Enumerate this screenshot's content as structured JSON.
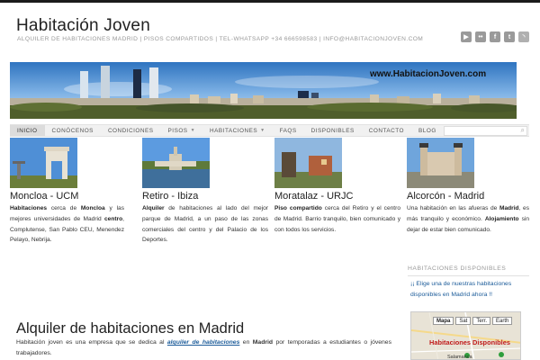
{
  "header": {
    "site_title": "Habitación Joven",
    "tagline": "ALQUILER DE HABITACIONES MADRID | PISOS COMPARTIDOS | TEL-WHATSAPP +34 666598583 | INFO@HABITACIONJOVEN.COM",
    "social_icons": [
      "youtube-icon",
      "flickr-icon",
      "facebook-icon",
      "twitter-icon",
      "rss-icon"
    ]
  },
  "banner": {
    "watermark": "www.HabitacionJoven.com"
  },
  "nav": {
    "items": [
      {
        "label": "INICIO"
      },
      {
        "label": "CONÓCENOS"
      },
      {
        "label": "CONDICIONES"
      },
      {
        "label": "PISOS"
      },
      {
        "label": "HABITACIONES"
      },
      {
        "label": "FAQS"
      },
      {
        "label": "DISPONIBLES"
      },
      {
        "label": "CONTACTO"
      },
      {
        "label": "BLOG"
      }
    ],
    "search_placeholder": ""
  },
  "cards": [
    {
      "title": "Moncloa - UCM",
      "t1": "Habitaciones",
      "t2": " cerca de ",
      "t3": "Moncloa",
      "t4": " y las mejores universidades de Madrid ",
      "t5": "centro",
      "t6": ", Complutense, San Pablo CEU, Menendez Pelayo, Nebrija."
    },
    {
      "title": "Retiro - Ibiza",
      "t1": "Alquiler",
      "t2": " de habitaciones al lado del mejor parque de Madrid, a un paso de las zonas comerciales del centro y del Palacio de los Deportes."
    },
    {
      "title": "Moratalaz - URJC",
      "t1": "Piso compartido",
      "t2": " cerca del Retiro y el centro de Madrid. Barrio tranquilo, bien comunicado y con todos los servicios."
    },
    {
      "title": "Alcorcón - Madrid",
      "t1": "Una habitación en las afueras de ",
      "t2": "Madrid",
      "t3": ", es más tranquilo y económico. ",
      "t4": "Alojamiento",
      "t5": " sin dejar de estar bien comunicado."
    }
  ],
  "sidebar": {
    "title": "HABITACIONES DISPONIBLES",
    "link": "¡¡ Elige una de nuestras habitaciones disponibles en Madrid ahora !!",
    "map": {
      "tabs": [
        "Mapa",
        "Sat",
        "Terr.",
        "Earth"
      ],
      "label": "Habitaciones Disponibles",
      "city": "Salamanca"
    }
  },
  "main": {
    "title": "Alquiler de habitaciones en Madrid",
    "p1": "Habitación joven es una empresa que se dedica al ",
    "link": "alquiler de habitaciones",
    "p2": " en ",
    "bold": "Madrid",
    "p3": " por temporadas a estudiantes o jóvenes trabajadores."
  },
  "colors": {
    "link": "#1b5b99",
    "map_label": "#c01a1a",
    "nav_bg": "#f1f1f1"
  }
}
